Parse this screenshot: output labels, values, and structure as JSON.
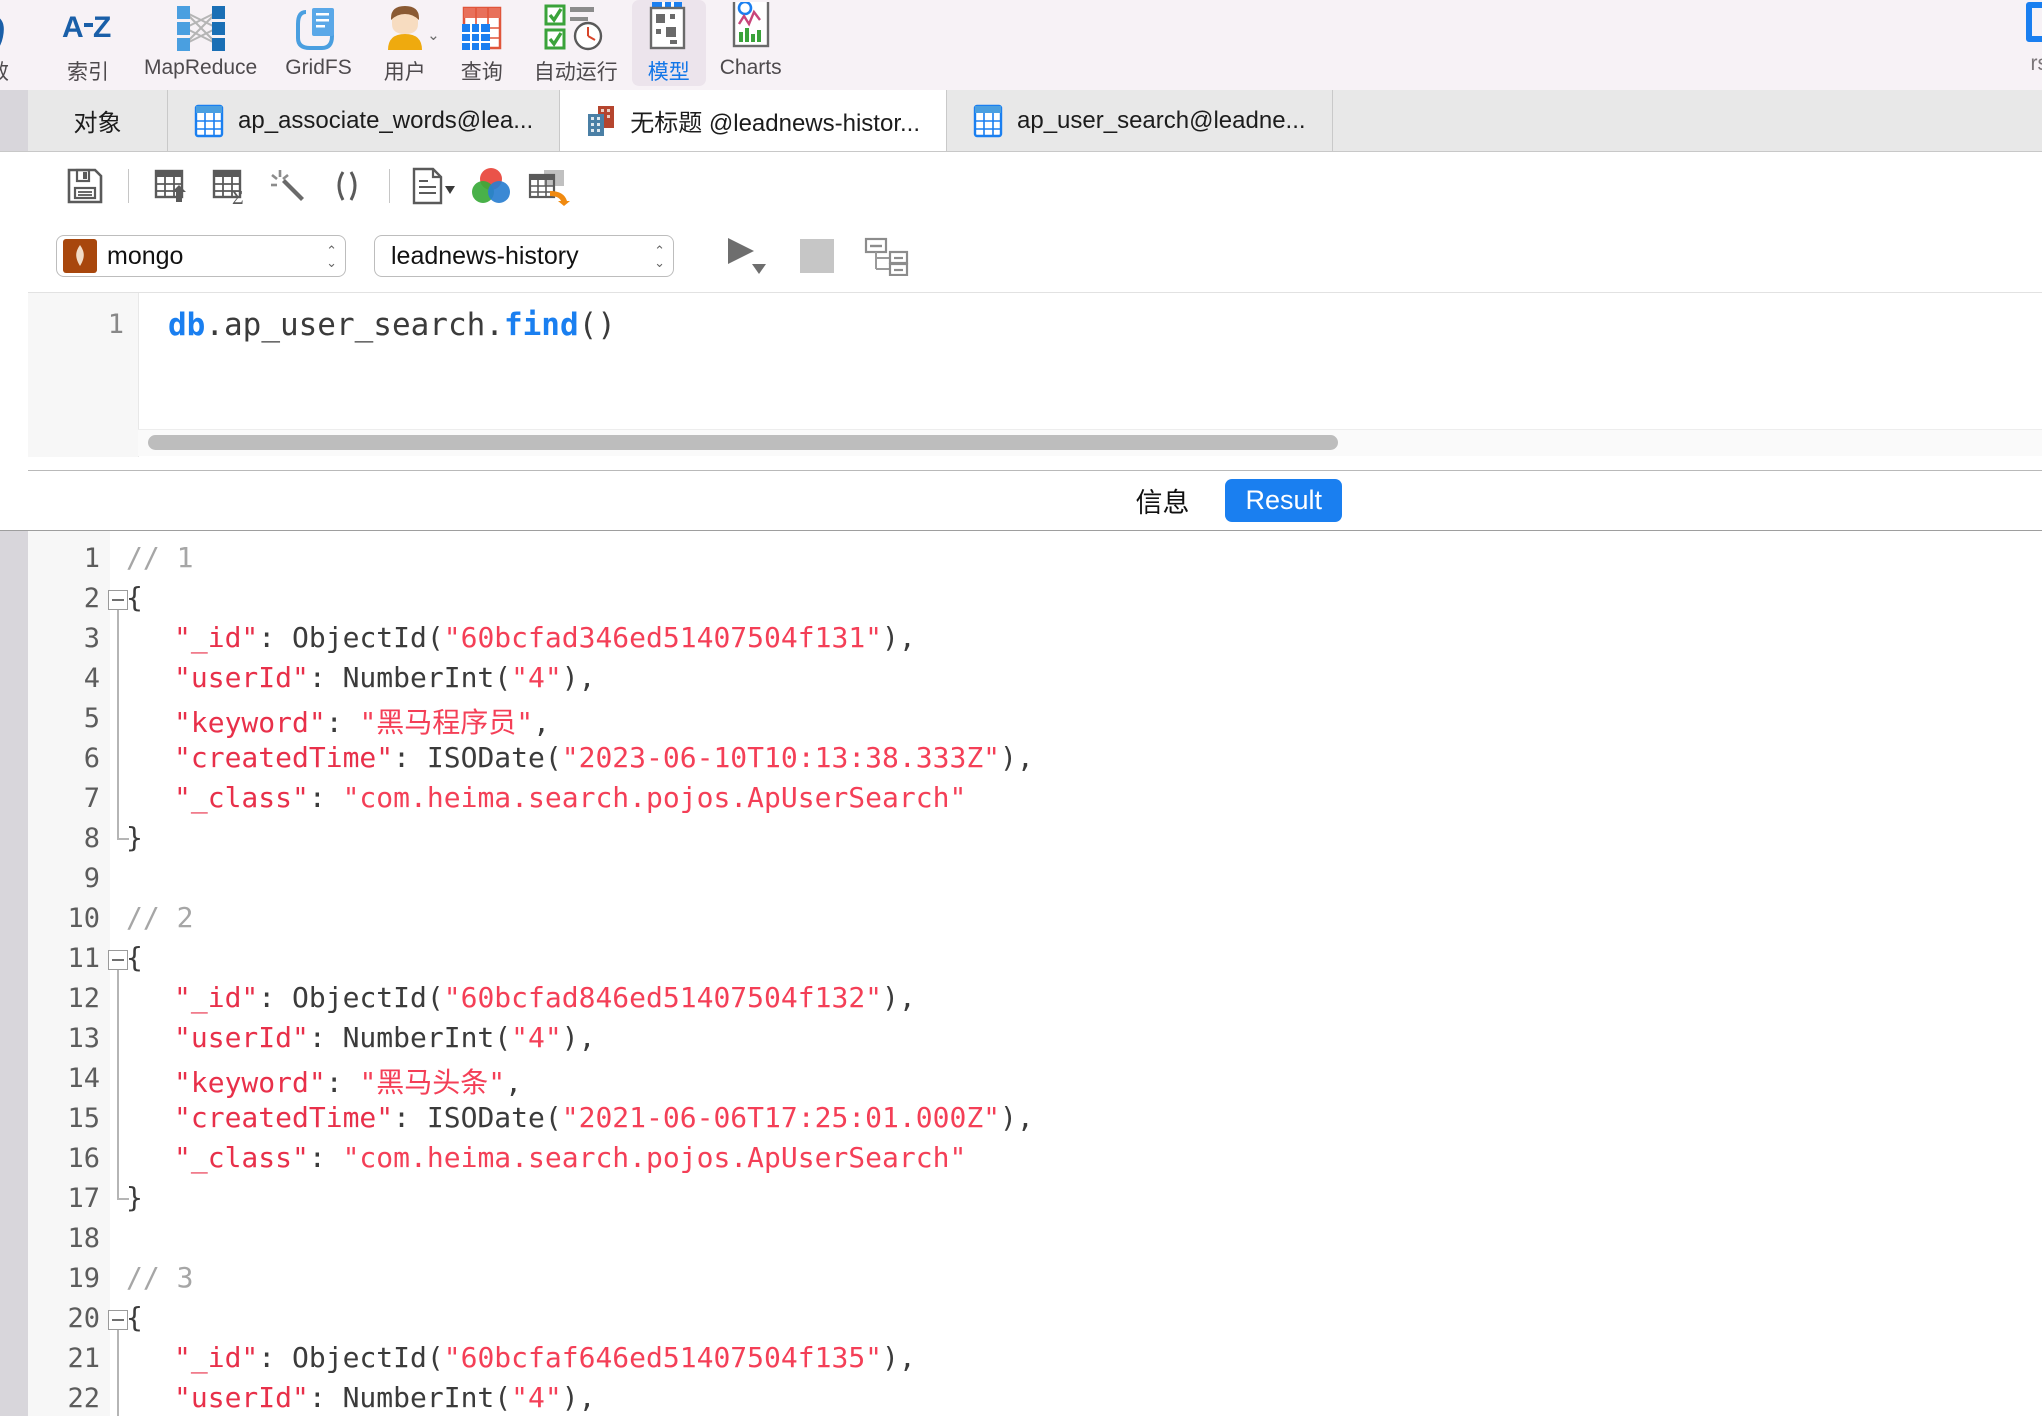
{
  "ribbon": {
    "partial_left": {
      "icon": "function-x-icon",
      "label": "效"
    },
    "items": [
      {
        "label": "索引",
        "icon": "az-index-icon",
        "active": false,
        "caret": false
      },
      {
        "label": "MapReduce",
        "icon": "mapreduce-icon",
        "active": false,
        "caret": false
      },
      {
        "label": "GridFS",
        "icon": "gridfs-icon",
        "active": false,
        "caret": false
      },
      {
        "label": "用户",
        "icon": "users-icon",
        "active": false,
        "caret": true
      },
      {
        "label": "查询",
        "icon": "query-icon",
        "active": false,
        "caret": false
      },
      {
        "label": "自动运行",
        "icon": "autorun-icon",
        "active": false,
        "caret": false
      },
      {
        "label": "模型",
        "icon": "model-icon",
        "active": true,
        "caret": false
      },
      {
        "label": "Charts",
        "icon": "charts-icon",
        "active": false,
        "caret": false
      }
    ],
    "partial_right": {
      "icon": "blue-square-icon",
      "label": "rs"
    }
  },
  "tabbar": {
    "objects_label": "对象",
    "tabs": [
      {
        "label": "ap_associate_words@lea...",
        "icon": "collection-table-icon",
        "active": false
      },
      {
        "label": "无标题 @leadnews-histor...",
        "icon": "query-document-icon",
        "active": true
      },
      {
        "label": "ap_user_search@leadne...",
        "icon": "collection-table-icon",
        "active": false
      }
    ]
  },
  "toolbar": {
    "buttons": [
      {
        "name": "save-icon",
        "title": "保存"
      },
      {
        "name": "sep"
      },
      {
        "name": "export-table-icon",
        "title": "导出"
      },
      {
        "name": "aggregate-sum-icon",
        "title": "聚合"
      },
      {
        "name": "magic-wand-icon",
        "title": "美化"
      },
      {
        "name": "brackets-icon",
        "title": "代码"
      },
      {
        "name": "sep"
      },
      {
        "name": "document-dropdown-icon",
        "title": "文档",
        "caret": true
      },
      {
        "name": "color-circles-icon",
        "title": "配色"
      },
      {
        "name": "table-export-arrow-icon",
        "title": "导出结果"
      }
    ]
  },
  "connection_bar": {
    "connection": {
      "value": "mongo",
      "icon": "mongodb-leaf-icon"
    },
    "database": {
      "value": "leadnews-history"
    },
    "run_button": {
      "name": "run-icon",
      "caret": true
    },
    "stop_button": {
      "name": "stop-icon"
    },
    "explain_button": {
      "name": "explain-plan-icon"
    }
  },
  "editor": {
    "line_number": "1",
    "code": {
      "prefix_kw": "db",
      "middle": ".ap_user_search.",
      "fn_kw": "find",
      "suffix": "()"
    },
    "full_text": "db.ap_user_search.find()"
  },
  "result_tabs": {
    "info_label": "信息",
    "result_label": "Result",
    "active": "Result"
  },
  "result": {
    "lines": [
      {
        "n": "1",
        "fold": false,
        "guide": "none",
        "indent": 0,
        "segments": [
          {
            "t": "// 1",
            "c": "s-com"
          }
        ]
      },
      {
        "n": "2",
        "fold": true,
        "guide": "start",
        "indent": 0,
        "segments": [
          {
            "t": "{",
            "c": "s-plain"
          }
        ]
      },
      {
        "n": "3",
        "fold": false,
        "guide": "mid",
        "indent": 1,
        "segments": [
          {
            "t": "\"_id\"",
            "c": "s-key"
          },
          {
            "t": ": ObjectId(",
            "c": "s-plain"
          },
          {
            "t": "\"60bcfad346ed51407504f131\"",
            "c": "s-str"
          },
          {
            "t": "),",
            "c": "s-plain"
          }
        ]
      },
      {
        "n": "4",
        "fold": false,
        "guide": "mid",
        "indent": 1,
        "segments": [
          {
            "t": "\"userId\"",
            "c": "s-key"
          },
          {
            "t": ": NumberInt(",
            "c": "s-plain"
          },
          {
            "t": "\"4\"",
            "c": "s-str"
          },
          {
            "t": "),",
            "c": "s-plain"
          }
        ]
      },
      {
        "n": "5",
        "fold": false,
        "guide": "mid",
        "indent": 1,
        "segments": [
          {
            "t": "\"keyword\"",
            "c": "s-key"
          },
          {
            "t": ": ",
            "c": "s-plain"
          },
          {
            "t": "\"黑马程序员\"",
            "c": "s-str"
          },
          {
            "t": ",",
            "c": "s-plain"
          }
        ]
      },
      {
        "n": "6",
        "fold": false,
        "guide": "mid",
        "indent": 1,
        "segments": [
          {
            "t": "\"createdTime\"",
            "c": "s-key"
          },
          {
            "t": ": ISODate(",
            "c": "s-plain"
          },
          {
            "t": "\"2023-06-10T10:13:38.333Z\"",
            "c": "s-str"
          },
          {
            "t": "),",
            "c": "s-plain"
          }
        ]
      },
      {
        "n": "7",
        "fold": false,
        "guide": "mid",
        "indent": 1,
        "segments": [
          {
            "t": "\"_class\"",
            "c": "s-key"
          },
          {
            "t": ": ",
            "c": "s-plain"
          },
          {
            "t": "\"com.heima.search.pojos.ApUserSearch\"",
            "c": "s-str"
          }
        ]
      },
      {
        "n": "8",
        "fold": false,
        "guide": "end",
        "indent": 0,
        "segments": [
          {
            "t": "}",
            "c": "s-plain"
          }
        ]
      },
      {
        "n": "9",
        "fold": false,
        "guide": "none",
        "indent": 0,
        "segments": []
      },
      {
        "n": "10",
        "fold": false,
        "guide": "none",
        "indent": 0,
        "segments": [
          {
            "t": "// 2",
            "c": "s-com"
          }
        ]
      },
      {
        "n": "11",
        "fold": true,
        "guide": "start",
        "indent": 0,
        "segments": [
          {
            "t": "{",
            "c": "s-plain"
          }
        ]
      },
      {
        "n": "12",
        "fold": false,
        "guide": "mid",
        "indent": 1,
        "segments": [
          {
            "t": "\"_id\"",
            "c": "s-key"
          },
          {
            "t": ": ObjectId(",
            "c": "s-plain"
          },
          {
            "t": "\"60bcfad846ed51407504f132\"",
            "c": "s-str"
          },
          {
            "t": "),",
            "c": "s-plain"
          }
        ]
      },
      {
        "n": "13",
        "fold": false,
        "guide": "mid",
        "indent": 1,
        "segments": [
          {
            "t": "\"userId\"",
            "c": "s-key"
          },
          {
            "t": ": NumberInt(",
            "c": "s-plain"
          },
          {
            "t": "\"4\"",
            "c": "s-str"
          },
          {
            "t": "),",
            "c": "s-plain"
          }
        ]
      },
      {
        "n": "14",
        "fold": false,
        "guide": "mid",
        "indent": 1,
        "segments": [
          {
            "t": "\"keyword\"",
            "c": "s-key"
          },
          {
            "t": ": ",
            "c": "s-plain"
          },
          {
            "t": "\"黑马头条\"",
            "c": "s-str"
          },
          {
            "t": ",",
            "c": "s-plain"
          }
        ]
      },
      {
        "n": "15",
        "fold": false,
        "guide": "mid",
        "indent": 1,
        "segments": [
          {
            "t": "\"createdTime\"",
            "c": "s-key"
          },
          {
            "t": ": ISODate(",
            "c": "s-plain"
          },
          {
            "t": "\"2021-06-06T17:25:01.000Z\"",
            "c": "s-str"
          },
          {
            "t": "),",
            "c": "s-plain"
          }
        ]
      },
      {
        "n": "16",
        "fold": false,
        "guide": "mid",
        "indent": 1,
        "segments": [
          {
            "t": "\"_class\"",
            "c": "s-key"
          },
          {
            "t": ": ",
            "c": "s-plain"
          },
          {
            "t": "\"com.heima.search.pojos.ApUserSearch\"",
            "c": "s-str"
          }
        ]
      },
      {
        "n": "17",
        "fold": false,
        "guide": "end",
        "indent": 0,
        "segments": [
          {
            "t": "}",
            "c": "s-plain"
          }
        ]
      },
      {
        "n": "18",
        "fold": false,
        "guide": "none",
        "indent": 0,
        "segments": []
      },
      {
        "n": "19",
        "fold": false,
        "guide": "none",
        "indent": 0,
        "segments": [
          {
            "t": "// 3",
            "c": "s-com"
          }
        ]
      },
      {
        "n": "20",
        "fold": true,
        "guide": "start",
        "indent": 0,
        "segments": [
          {
            "t": "{",
            "c": "s-plain"
          }
        ]
      },
      {
        "n": "21",
        "fold": false,
        "guide": "mid",
        "indent": 1,
        "segments": [
          {
            "t": "\"_id\"",
            "c": "s-key"
          },
          {
            "t": ": ObjectId(",
            "c": "s-plain"
          },
          {
            "t": "\"60bcfaf646ed51407504f135\"",
            "c": "s-str"
          },
          {
            "t": "),",
            "c": "s-plain"
          }
        ]
      },
      {
        "n": "22",
        "fold": false,
        "guide": "mid",
        "indent": 1,
        "segments": [
          {
            "t": "\"userId\"",
            "c": "s-key"
          },
          {
            "t": ": NumberInt(",
            "c": "s-plain"
          },
          {
            "t": "\"4\"",
            "c": "s-str"
          },
          {
            "t": "),",
            "c": "s-plain"
          }
        ]
      }
    ]
  },
  "colors": {
    "accent_blue": "#1a7ff0",
    "string_red": "#f43f57",
    "key_red": "#e8304a",
    "ribbon_bg": "#f7f2f6",
    "mongo_brown": "#a8470d"
  }
}
